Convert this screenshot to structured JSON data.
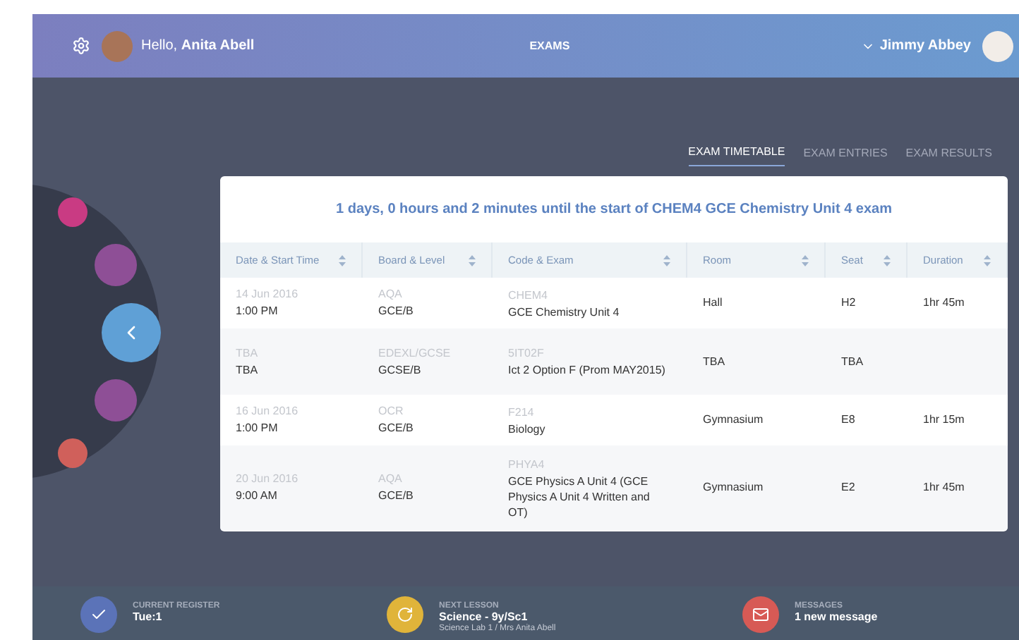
{
  "header": {
    "greeting": "Hello, ",
    "user_name": "Anita Abell",
    "title": "EXAMS",
    "account_name": "Jimmy Abbey"
  },
  "tabs": [
    {
      "label": "EXAM TIMETABLE",
      "selected": true
    },
    {
      "label": "EXAM ENTRIES",
      "selected": false
    },
    {
      "label": "EXAM RESULTS",
      "selected": false
    }
  ],
  "countdown": "1 days, 0 hours and 2 minutes until the start of CHEM4 GCE Chemistry Unit 4 exam",
  "table": {
    "columns": [
      "Date & Start Time",
      "Board & Level",
      "Code & Exam",
      "Room",
      "Seat",
      "Duration"
    ],
    "rows": [
      {
        "date": "14 Jun 2016",
        "time": "1:00 PM",
        "board": "AQA",
        "level": "GCE/B",
        "code": "CHEM4",
        "exam": "GCE Chemistry Unit 4",
        "room": "Hall",
        "seat": "H2",
        "duration": "1hr 45m"
      },
      {
        "date": "TBA",
        "time": "TBA",
        "board": "EDEXL/GCSE",
        "level": "GCSE/B",
        "code": "5IT02F",
        "exam": "Ict 2 Option F (Prom MAY2015)",
        "room": "TBA",
        "seat": "TBA"
      },
      {
        "date": "16 Jun 2016",
        "time": "1:00 PM",
        "board": "OCR",
        "level": "GCE/B",
        "code": "F214",
        "exam": "Biology",
        "room": "Gymnasium",
        "seat": "E8",
        "duration": "1hr 15m"
      },
      {
        "date": "20 Jun 2016",
        "time": "9:00 AM",
        "board": "AQA",
        "level": "GCE/B",
        "code": "PHYA4",
        "exam": "GCE Physics A Unit 4 (GCE Physics A Unit 4 Written and OT)",
        "room": "Gymnasium",
        "seat": "E2",
        "duration": "1hr 45m"
      }
    ]
  },
  "footer": [
    {
      "kind": "register",
      "label": "CURRENT REGISTER",
      "value": "Tue:1"
    },
    {
      "kind": "lesson",
      "label": "NEXT LESSON",
      "value": "Science - 9y/Sc1",
      "detail": "Science Lab 1 / Mrs Anita Abell"
    },
    {
      "kind": "messages",
      "label": "MESSAGES",
      "value": "1 new message"
    }
  ]
}
